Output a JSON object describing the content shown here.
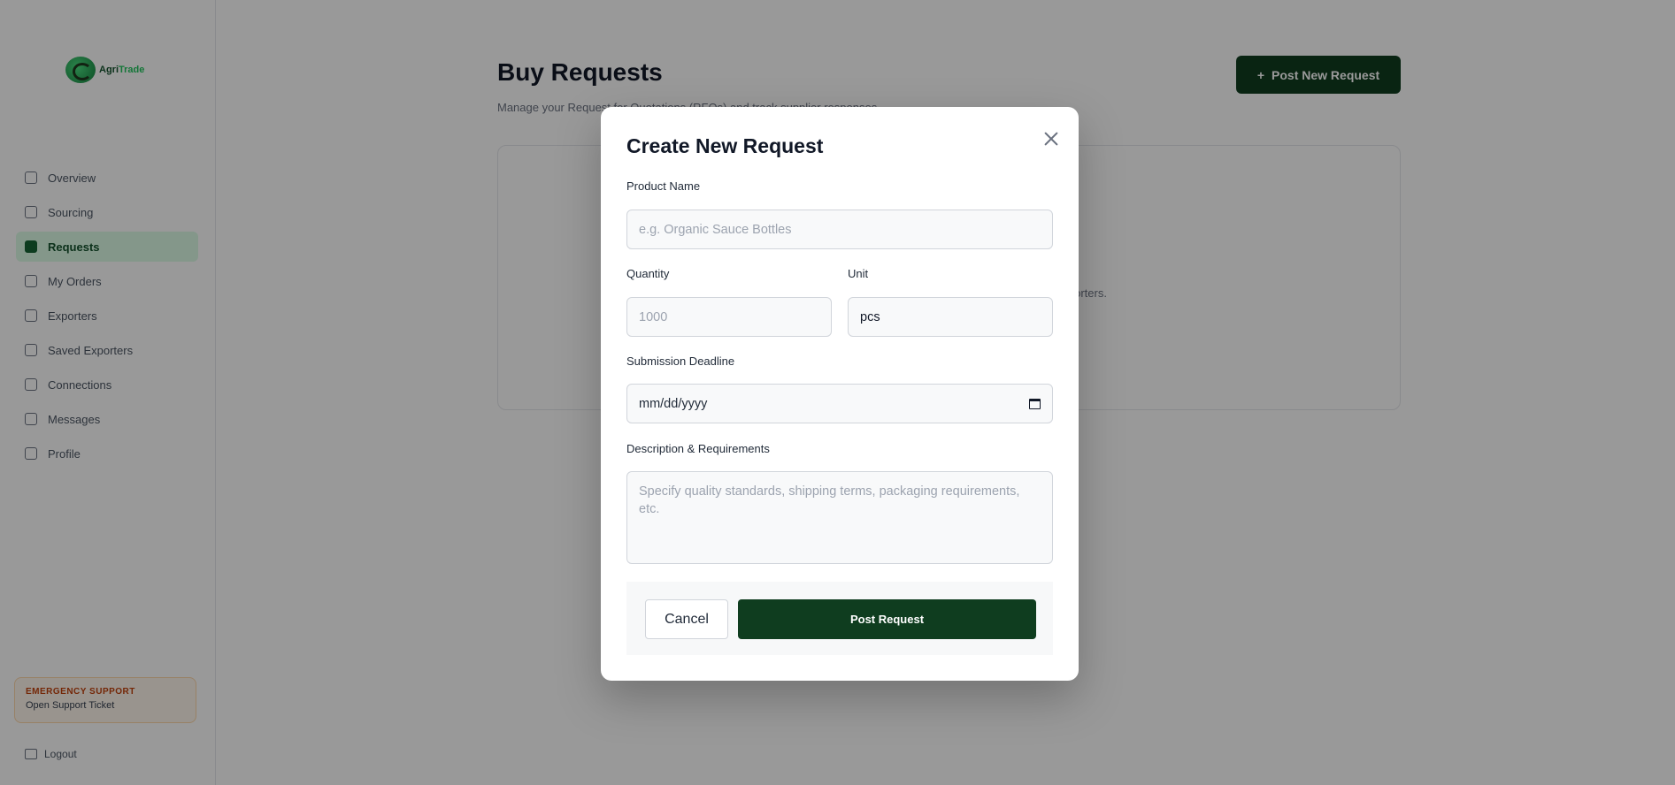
{
  "app": {
    "logo_text_a": "Agri",
    "logo_text_b": "Trade",
    "nav": [
      {
        "label": "Overview"
      },
      {
        "label": "Sourcing"
      },
      {
        "label": "Requests"
      },
      {
        "label": "My Orders"
      },
      {
        "label": "Exporters"
      },
      {
        "label": "Saved Exporters"
      },
      {
        "label": "Connections"
      },
      {
        "label": "Messages"
      },
      {
        "label": "Profile"
      }
    ],
    "emergency_title": "EMERGENCY SUPPORT",
    "emergency_sub": "Open Support Ticket",
    "logout": "Logout",
    "page_title": "Buy Requests",
    "page_sub": "Manage your Request for Quotations (RFQs) and track supplier responses.",
    "post_new_label": "Post New Request",
    "empty_text": "...global exporters."
  },
  "modal": {
    "title": "Create New Request",
    "product_name_label": "Product Name",
    "product_name_placeholder": "e.g. Organic Sauce Bottles",
    "quantity_label": "Quantity",
    "quantity_placeholder": "1000",
    "unit_label": "Unit",
    "unit_value": "pcs",
    "deadline_label": "Submission Deadline",
    "deadline_value": "mm/dd/yyyy",
    "description_label": "Description & Requirements",
    "description_placeholder": "Specify quality standards, shipping terms, packaging requirements, etc.",
    "cancel_label": "Cancel",
    "submit_label": "Post Request"
  },
  "colors": {
    "primary": "#0f3d1f",
    "accent": "#22c55e",
    "overlay": "rgba(0,0,0,0.40)"
  }
}
